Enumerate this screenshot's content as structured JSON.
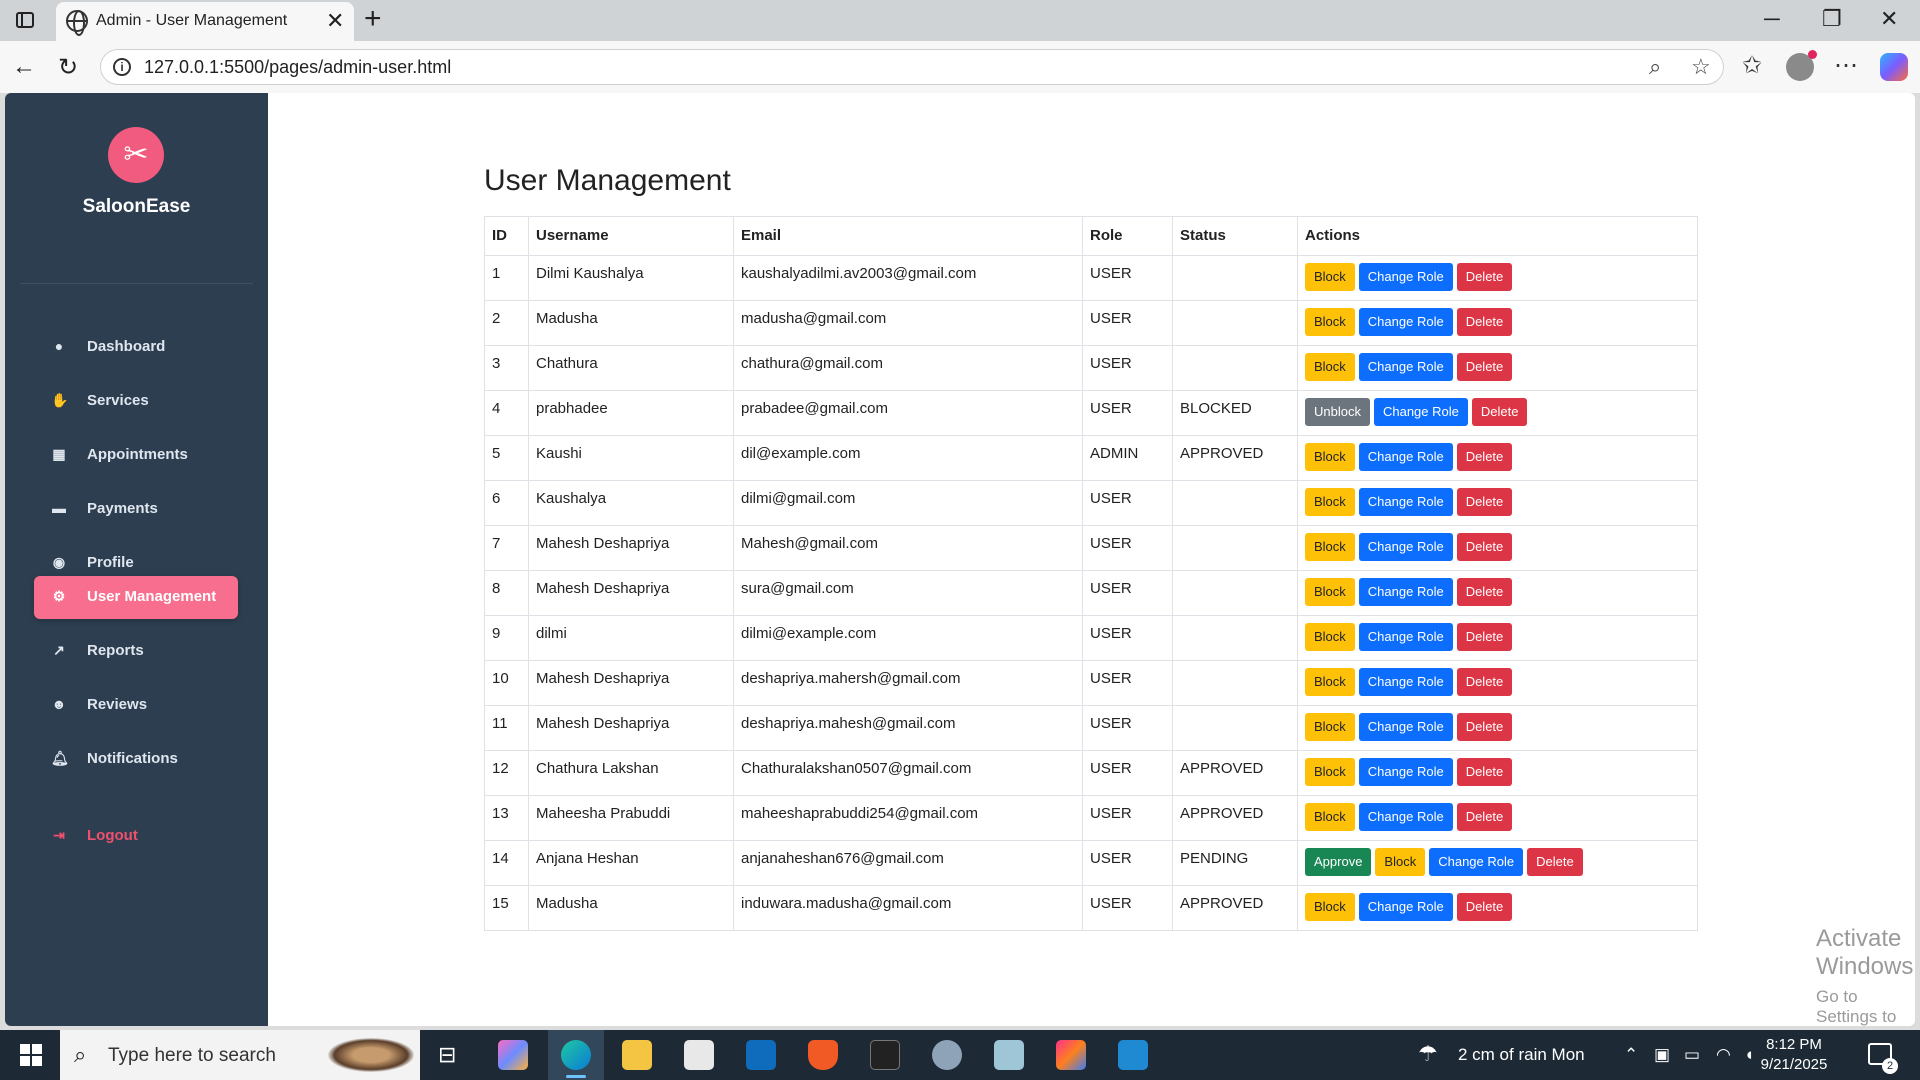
{
  "browser": {
    "tab_title": "Admin - User Management",
    "url": "127.0.0.1:5500/pages/admin-user.html"
  },
  "sidebar": {
    "brand": "SaloonEase",
    "items": [
      {
        "label": "Dashboard",
        "icon": "dashboard-icon"
      },
      {
        "label": "Services",
        "icon": "services-icon"
      },
      {
        "label": "Appointments",
        "icon": "calendar-icon"
      },
      {
        "label": "Payments",
        "icon": "credit-card-icon"
      },
      {
        "label": "Profile",
        "icon": "profile-icon"
      },
      {
        "label": "User Management",
        "icon": "gear-icon",
        "active": true
      },
      {
        "label": "Reports",
        "icon": "chart-line-icon"
      },
      {
        "label": "Reviews",
        "icon": "users-icon"
      },
      {
        "label": "Notifications",
        "icon": "bell-icon"
      }
    ],
    "logout": "Logout"
  },
  "main": {
    "title": "User Management",
    "columns": [
      "ID",
      "Username",
      "Email",
      "Role",
      "Status",
      "Actions"
    ],
    "rows": [
      {
        "id": "1",
        "username": "Dilmi Kaushalya",
        "email": "kaushalyadilmi.av2003@gmail.com",
        "role": "USER",
        "status": "",
        "actions": [
          "Block",
          "Change Role",
          "Delete"
        ]
      },
      {
        "id": "2",
        "username": "Madusha",
        "email": "madusha@gmail.com",
        "role": "USER",
        "status": "",
        "actions": [
          "Block",
          "Change Role",
          "Delete"
        ]
      },
      {
        "id": "3",
        "username": "Chathura",
        "email": "chathura@gmail.com",
        "role": "USER",
        "status": "",
        "actions": [
          "Block",
          "Change Role",
          "Delete"
        ]
      },
      {
        "id": "4",
        "username": "prabhadee",
        "email": "prabadee@gmail.com",
        "role": "USER",
        "status": "BLOCKED",
        "actions": [
          "Unblock",
          "Change Role",
          "Delete"
        ]
      },
      {
        "id": "5",
        "username": "Kaushi",
        "email": "dil@example.com",
        "role": "ADMIN",
        "status": "APPROVED",
        "actions": [
          "Block",
          "Change Role",
          "Delete"
        ]
      },
      {
        "id": "6",
        "username": "Kaushalya",
        "email": "dilmi@gmail.com",
        "role": "USER",
        "status": "",
        "actions": [
          "Block",
          "Change Role",
          "Delete"
        ]
      },
      {
        "id": "7",
        "username": "Mahesh Deshapriya",
        "email": "Mahesh@gmail.com",
        "role": "USER",
        "status": "",
        "actions": [
          "Block",
          "Change Role",
          "Delete"
        ]
      },
      {
        "id": "8",
        "username": "Mahesh Deshapriya",
        "email": "sura@gmail.com",
        "role": "USER",
        "status": "",
        "actions": [
          "Block",
          "Change Role",
          "Delete"
        ]
      },
      {
        "id": "9",
        "username": "dilmi",
        "email": "dilmi@example.com",
        "role": "USER",
        "status": "",
        "actions": [
          "Block",
          "Change Role",
          "Delete"
        ]
      },
      {
        "id": "10",
        "username": "Mahesh Deshapriya",
        "email": "deshapriya.mahersh@gmail.com",
        "role": "USER",
        "status": "",
        "actions": [
          "Block",
          "Change Role",
          "Delete"
        ]
      },
      {
        "id": "11",
        "username": "Mahesh Deshapriya",
        "email": "deshapriya.mahesh@gmail.com",
        "role": "USER",
        "status": "",
        "actions": [
          "Block",
          "Change Role",
          "Delete"
        ]
      },
      {
        "id": "12",
        "username": "Chathura Lakshan",
        "email": "Chathuralakshan0507@gmail.com",
        "role": "USER",
        "status": "APPROVED",
        "actions": [
          "Block",
          "Change Role",
          "Delete"
        ]
      },
      {
        "id": "13",
        "username": "Maheesha Prabuddi",
        "email": "maheeshaprabuddi254@gmail.com",
        "role": "USER",
        "status": "APPROVED",
        "actions": [
          "Block",
          "Change Role",
          "Delete"
        ]
      },
      {
        "id": "14",
        "username": "Anjana Heshan",
        "email": "anjanaheshan676@gmail.com",
        "role": "USER",
        "status": "PENDING",
        "actions": [
          "Approve",
          "Block",
          "Change Role",
          "Delete"
        ]
      },
      {
        "id": "15",
        "username": "Madusha",
        "email": "induwara.madusha@gmail.com",
        "role": "USER",
        "status": "APPROVED",
        "actions": [
          "Block",
          "Change Role",
          "Delete"
        ]
      }
    ]
  },
  "watermark": {
    "line1": "Activate Windows",
    "line2": "Go to Settings to activate Windows."
  },
  "taskbar": {
    "search_placeholder": "Type here to search",
    "weather": "2 cm of rain Mon",
    "time": "8:12 PM",
    "date": "9/21/2025",
    "notification_count": "2"
  },
  "colors": {
    "sidebar_bg": "#2d3e50",
    "accent_pink": "#f76e8e",
    "btn_block": "#ffc107",
    "btn_change_role": "#0d6efd",
    "btn_delete": "#dc3545",
    "btn_unblock": "#6c757d",
    "btn_approve": "#198754"
  }
}
